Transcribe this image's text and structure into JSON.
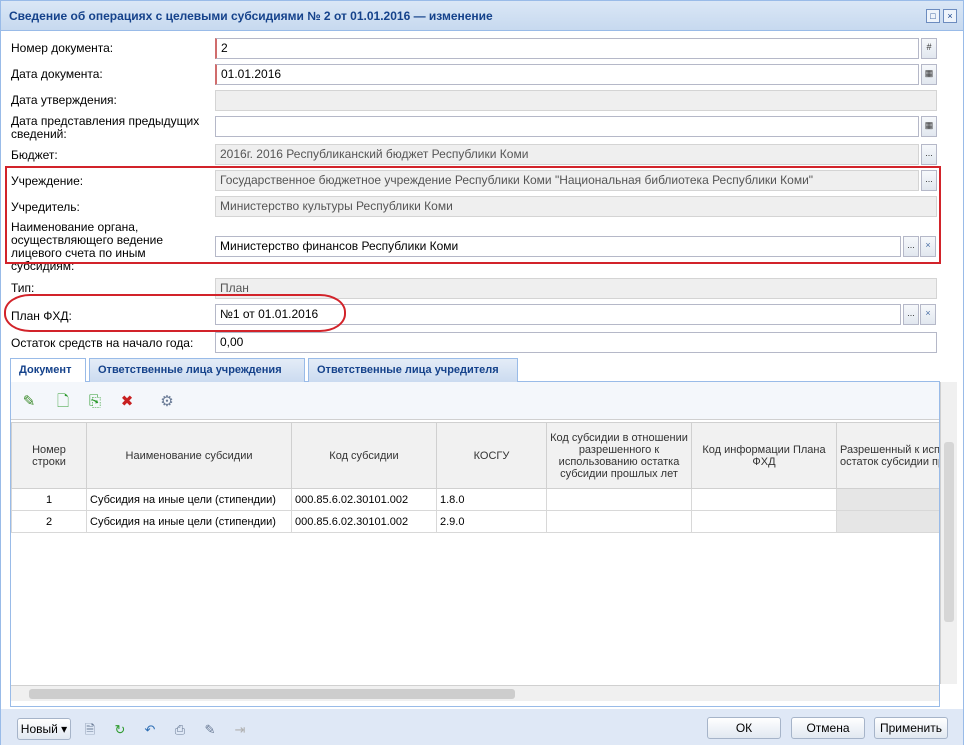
{
  "window": {
    "title": "Сведение об операциях с целевыми субсидиями № 2 от 01.01.2016 — изменение",
    "restore_glyph": "□",
    "close_glyph": "×"
  },
  "form": {
    "doc_number_label": "Номер документа:",
    "doc_number_value": "2",
    "doc_date_label": "Дата документа:",
    "doc_date_value": "01.01.2016",
    "approve_date_label": "Дата утверждения:",
    "approve_date_value": "",
    "prev_date_label": "Дата представления предыдущих сведений:",
    "prev_date_value": "",
    "budget_label": "Бюджет:",
    "budget_value": "2016г. 2016 Республиканский бюджет Республики Коми",
    "institution_label": "Учреждение:",
    "institution_value": "Государственное бюджетное учреждение Республики Коми \"Национальная библиотека Республики Коми\"",
    "founder_label": "Учредитель:",
    "founder_value": "Министерство культуры Республики Коми",
    "organ_label": "Наименование органа, осуществляющего ведение лицевого счета по иным субсидиям:",
    "organ_value": "Министерство финансов Республики Коми",
    "type_label": "Тип:",
    "type_value": "План",
    "plan_label": "План ФХД:",
    "plan_value": "№1 от 01.01.2016",
    "balance_label": "Остаток средств на начало года:",
    "balance_value": "0,00",
    "hash_glyph": "#",
    "lookup_glyph": "...",
    "clear_glyph": "×"
  },
  "tabs": [
    {
      "label": "Документ"
    },
    {
      "label": "Ответственные лица учреждения"
    },
    {
      "label": "Ответственные лица учредителя"
    }
  ],
  "toolbar_icons": [
    "edit-icon",
    "add-icon",
    "copy-add-icon",
    "delete-icon",
    "settings-icon"
  ],
  "grid": {
    "columns": [
      "Номер строки",
      "Наименование субсидии",
      "Код субсидии",
      "КОСГУ",
      "Код субсидии в отношении разрешенного к использованию остатка субсидии прошлых лет",
      "Код информации Плана ФХД",
      "Разрешенный к использованию остаток субсидии прошлых лет"
    ],
    "rows": [
      {
        "num": "1",
        "name": "Субсидия на иные цели (стипендии)",
        "code": "000.85.6.02.30101.002",
        "kosgu": "1.8.0",
        "prev_code": "",
        "fhd_code": "",
        "allowed": ""
      },
      {
        "num": "2",
        "name": "Субсидия на иные цели (стипендии)",
        "code": "000.85.6.02.30101.002",
        "kosgu": "2.9.0",
        "prev_code": "",
        "fhd_code": "",
        "allowed": ""
      }
    ]
  },
  "footer": {
    "new_label": "Новый ▾",
    "ok_label": "ОК",
    "cancel_label": "Отмена",
    "apply_label": "Применить"
  },
  "colors": {
    "title": "#15428b",
    "highlight": "#d2232a",
    "frame": "#99bbe8"
  }
}
